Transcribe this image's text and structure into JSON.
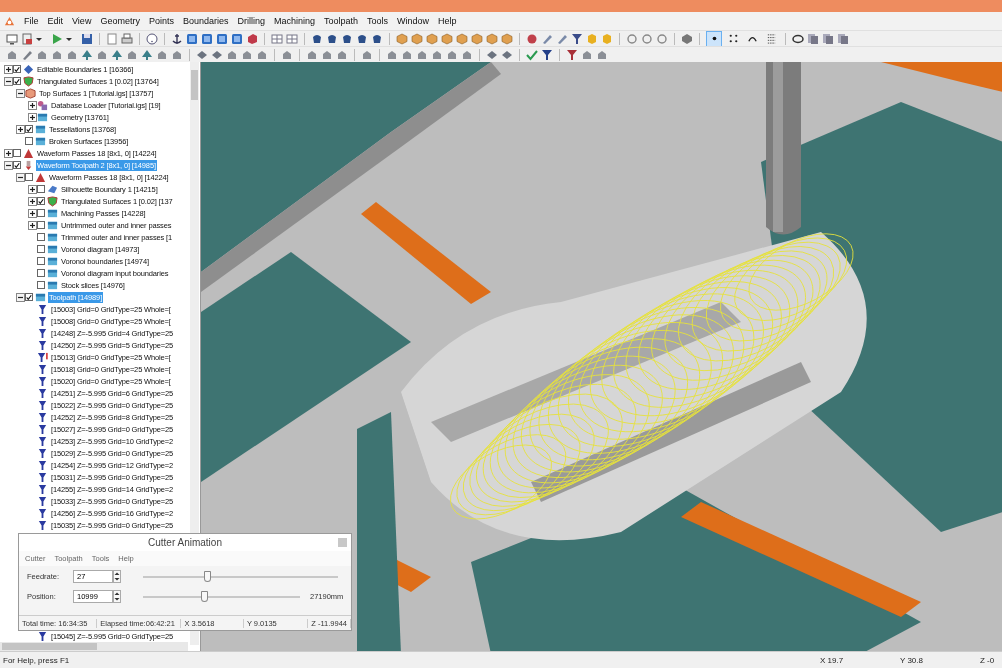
{
  "menu": [
    "File",
    "Edit",
    "View",
    "Geometry",
    "Points",
    "Boundaries",
    "Drilling",
    "Machining",
    "Toolpath",
    "Tools",
    "Window",
    "Help"
  ],
  "display_modes": [
    {
      "kind": "point",
      "selected": true
    },
    {
      "kind": "dots",
      "selected": false
    },
    {
      "kind": "arc",
      "selected": false
    },
    {
      "kind": "grid",
      "selected": false
    }
  ],
  "tree": [
    {
      "label": "Editable Boundaries 1 [16366]",
      "kind": "boundary",
      "checked": true,
      "expanded": false,
      "selected": false
    },
    {
      "label": "Triangulated Surfaces 1 [0.02] [13764]",
      "kind": "surfaces",
      "checked": true,
      "expanded": true,
      "selected": false,
      "children": [
        {
          "label": "Top Surfaces 1 [Tutorial.igs] [13757]",
          "kind": "model",
          "expanded": true,
          "selected": false,
          "children": [
            {
              "label": "Database Loader [Tutorial.igs] [19]",
              "kind": "loader",
              "expanded": false,
              "selected": false
            },
            {
              "label": "Geometry [13761]",
              "kind": "layer",
              "expanded": false,
              "selected": false
            }
          ]
        },
        {
          "label": "Tessellations [13768]",
          "kind": "layer",
          "checked": true,
          "expanded": false,
          "selected": false
        },
        {
          "label": "Broken Surfaces [13956]",
          "kind": "layer",
          "checked": false,
          "selected": false
        }
      ]
    },
    {
      "label": "Waveform Passes 18 [8x1, 0] [14224]",
      "kind": "passes",
      "checked": false,
      "expanded": false,
      "selected": false
    },
    {
      "label": "Waveform Toolpath 2 [8x1, 0] [14985]",
      "kind": "cutter",
      "checked": true,
      "expanded": true,
      "selected": true,
      "children": [
        {
          "label": "Waveform Passes 18 [8x1, 0] [14224]",
          "kind": "passes",
          "checked": false,
          "expanded": true,
          "selected": false,
          "children": [
            {
              "label": "Silhouette Boundary 1 [14215]",
              "kind": "silhouette",
              "checked": false,
              "expanded": false,
              "selected": false
            },
            {
              "label": "Triangulated Surfaces 1 [0.02] [137",
              "kind": "surfaces",
              "checked": true,
              "expanded": false,
              "selected": false
            },
            {
              "label": "Machining Passes [14228]",
              "kind": "layer",
              "checked": false,
              "expanded": false,
              "selected": false
            },
            {
              "label": "Untrimmed outer and inner passes",
              "kind": "layer",
              "checked": false,
              "expanded": false,
              "selected": false
            },
            {
              "label": "Trimmed outer and inner passes [1",
              "kind": "layer",
              "checked": false,
              "selected": false
            },
            {
              "label": "Voronoi diagram [14973]",
              "kind": "layer",
              "checked": false,
              "selected": false
            },
            {
              "label": "Voronoi boundaries [14974]",
              "kind": "layer",
              "checked": false,
              "selected": false
            },
            {
              "label": "Voronoi diagram input boundaries",
              "kind": "layer",
              "checked": false,
              "selected": false
            },
            {
              "label": "Stock slices [14976]",
              "kind": "layer",
              "checked": false,
              "selected": false
            }
          ]
        },
        {
          "label": "Toolpath [14989]",
          "kind": "layer",
          "checked": true,
          "expanded": true,
          "selected": true,
          "children": [
            {
              "label": "[15003] Grid=0 GridType=25 Whole=[",
              "kind": "toolpath",
              "selected": false
            },
            {
              "label": "[15008] Grid=0 GridType=25 Whole=[",
              "kind": "toolpath",
              "selected": false
            },
            {
              "label": "[14248] Z=-5.995 Grid=4 GridType=25",
              "kind": "toolpath",
              "selected": false
            },
            {
              "label": "[14250] Z=-5.995 Grid=5 GridType=25",
              "kind": "toolpath",
              "selected": false
            },
            {
              "label": "[15013] Grid=0 GridType=25 Whole=[",
              "kind": "toolpath-flagged",
              "selected": false
            },
            {
              "label": "[15018] Grid=0 GridType=25 Whole=[",
              "kind": "toolpath",
              "selected": false
            },
            {
              "label": "[15020] Grid=0 GridType=25 Whole=[",
              "kind": "toolpath",
              "selected": false
            },
            {
              "label": "[14251] Z=-5.995 Grid=6 GridType=25",
              "kind": "toolpath",
              "selected": false
            },
            {
              "label": "[15022] Z=-5.995 Grid=0 GridType=25",
              "kind": "toolpath",
              "selected": false
            },
            {
              "label": "[14252] Z=-5.995 Grid=8 GridType=25",
              "kind": "toolpath",
              "selected": false
            },
            {
              "label": "[15027] Z=-5.995 Grid=0 GridType=25",
              "kind": "toolpath",
              "selected": false
            },
            {
              "label": "[14253] Z=-5.995 Grid=10 GridType=2",
              "kind": "toolpath",
              "selected": false
            },
            {
              "label": "[15029] Z=-5.995 Grid=0 GridType=25",
              "kind": "toolpath",
              "selected": false
            },
            {
              "label": "[14254] Z=-5.995 Grid=12 GridType=2",
              "kind": "toolpath",
              "selected": false
            },
            {
              "label": "[15031] Z=-5.995 Grid=0 GridType=25",
              "kind": "toolpath",
              "selected": false
            },
            {
              "label": "[14255] Z=-5.995 Grid=14 GridType=2",
              "kind": "toolpath",
              "selected": false
            },
            {
              "label": "[15033] Z=-5.995 Grid=0 GridType=25",
              "kind": "toolpath",
              "selected": false
            },
            {
              "label": "[14256] Z=-5.995 Grid=16 GridType=2",
              "kind": "toolpath",
              "selected": false
            },
            {
              "label": "[15035] Z=-5.995 Grid=0 GridType=25",
              "kind": "toolpath",
              "selected": false
            }
          ]
        }
      ]
    }
  ],
  "tree_below_dialog": [
    {
      "label": "[15045] Z=-5.995 Grid=0 GridType=25",
      "kind": "toolpath",
      "selected": false
    }
  ],
  "cutter_animation": {
    "title": "Cutter Animation",
    "menu": [
      "Cutter",
      "Toolpath",
      "Tools",
      "Help"
    ],
    "feedrate": {
      "label": "Feedrate:",
      "value": "27",
      "level": 0.33
    },
    "position": {
      "label": "Position:",
      "value": "10999",
      "level": 0.39,
      "reading": "27190mm"
    },
    "status": [
      "Total time: 16:34:35",
      "Elapsed time:06:42:21",
      "X 3.5618",
      "Y 9.0135",
      "Z -11.9944"
    ]
  },
  "status_bar": {
    "message": "For Help, press F1",
    "coords": [
      "X 19.7",
      "Y 30.8",
      "Z -0"
    ]
  }
}
